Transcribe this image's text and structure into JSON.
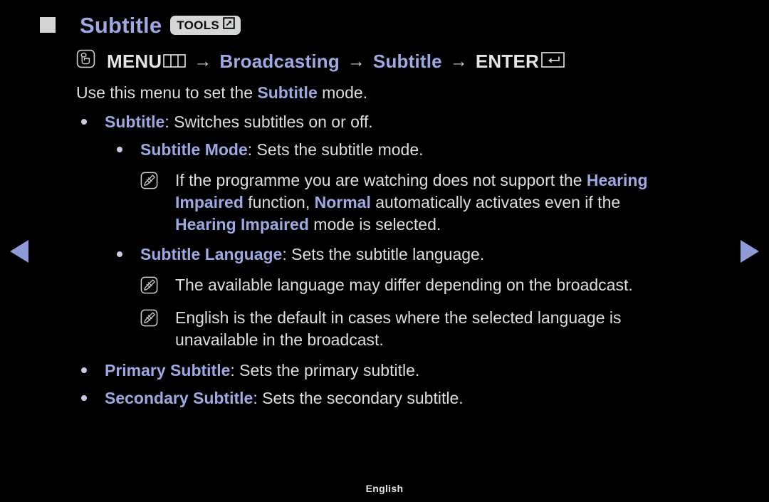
{
  "page": {
    "background_color": "#000000",
    "accent_color": "#9ea8e2",
    "text_color": "#dedede",
    "footer_language": "English"
  },
  "header": {
    "title": "Subtitle",
    "tools_badge_label": "TOOLS",
    "tools_badge_icon": "popup-window-arrow-icon"
  },
  "menu_path": {
    "touch_icon": "hand-press-icon",
    "step1": "MENU",
    "step1_icon": "menu-grid-icon",
    "arrow": "→",
    "step2": "Broadcasting",
    "step3": "Subtitle",
    "step4": "ENTER",
    "step4_icon": "enter-key-icon"
  },
  "intro": {
    "prefix": "Use this menu to set the ",
    "term": "Subtitle",
    "suffix": " mode."
  },
  "items": [
    {
      "term": "Subtitle",
      "desc": ": Switches subtitles on or off."
    },
    {
      "term": "Subtitle Mode",
      "desc": ": Sets the subtitle mode."
    },
    {
      "term": "Subtitle Language",
      "desc": ": Sets the subtitle language."
    },
    {
      "term": "Primary Subtitle",
      "desc": ": Sets the primary subtitle."
    },
    {
      "term": "Secondary Subtitle",
      "desc": ": Sets the secondary subtitle."
    }
  ],
  "notes": {
    "note1": {
      "icon": "note-pen-icon",
      "l1a": "If the programme you are watching does not support the ",
      "l1b": "Hearing",
      "l2a": "Impaired",
      "l2b": " function, ",
      "l2c": "Normal",
      "l2d": " automatically activates even if the",
      "l3a": "Hearing Impaired",
      "l3b": " mode is selected."
    },
    "note2": {
      "icon": "note-pen-icon",
      "text": "The available language may differ depending on the broadcast."
    },
    "note3": {
      "icon": "note-pen-icon",
      "l1": "English is the default in cases where the selected language is",
      "l2": "unavailable in the broadcast."
    }
  },
  "nav": {
    "prev_label": "previous-page-arrow",
    "next_label": "next-page-arrow"
  }
}
